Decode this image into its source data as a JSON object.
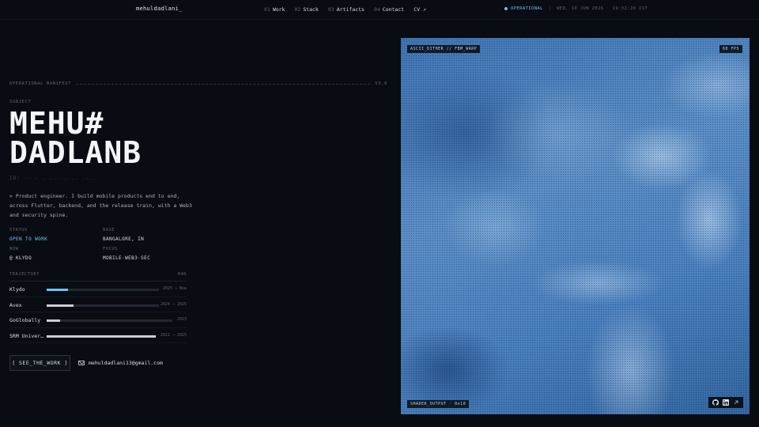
{
  "header": {
    "logo": "mehuldadlani_",
    "nav": [
      {
        "num": "01",
        "label": "Work"
      },
      {
        "num": "02",
        "label": "Stack"
      },
      {
        "num": "03",
        "label": "Artifacts"
      },
      {
        "num": "04",
        "label": "Contact"
      },
      {
        "num": "",
        "label": "CV ↗"
      }
    ],
    "status": "OPERATIONAL",
    "datetime": "WED, 10 JUN 2026 · 19:32:20 IST"
  },
  "manifest": {
    "label": "OPERATIONAL MANIFEST",
    "version": "V3.0"
  },
  "subject": {
    "label": "SUBJECT",
    "name_line1": "MEHU#",
    "name_line2": "DADLANB",
    "id_line": "ID: -- - . ... . .. .-.."
  },
  "bio": "> Product engineer. I build mobile products end to end, across Flutter, backend, and the release train, with a Web3 and security spine.",
  "meta": {
    "status_label": "STATUS",
    "status_value": "OPEN TO WORK",
    "base_label": "BASE",
    "base_value": "BANGALORE, IN",
    "now_label": "NOW",
    "now_value": "@ KLYDO",
    "focus_label": "FOCUS",
    "focus_value": "MOBILE·WEB3·SEC"
  },
  "trajectory": {
    "label": "TRAJECTORY",
    "count": "04R",
    "items": [
      {
        "name": "Klydo",
        "dates": "2025 → Now",
        "fill": 0.19,
        "current": true
      },
      {
        "name": "Avex",
        "dates": "2024 → 2025",
        "fill": 0.24,
        "current": false
      },
      {
        "name": "GoGlobally",
        "dates": "2023",
        "fill": 0.11,
        "current": false
      },
      {
        "name": "SRM University",
        "dates": "2021 → 2025",
        "fill": 0.99,
        "current": false
      }
    ]
  },
  "cta": {
    "label": "[ SEE_THE_WORK ]"
  },
  "email": "mehuldadlani13@gmail.com",
  "shader": {
    "tag_top_left": "ASCII_DITHER // FBM_WARP",
    "tag_top_right": "60 FPS",
    "tag_bottom_left": "SHADER_OUTPUT · 0x10"
  },
  "social_icons": [
    "github-icon",
    "linkedin-icon",
    "external-link-icon"
  ],
  "colors": {
    "accent": "#6cc3f0",
    "background": "#090c12"
  }
}
